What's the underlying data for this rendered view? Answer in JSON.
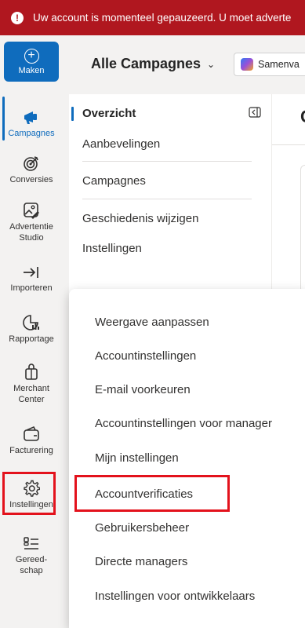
{
  "banner": {
    "message": "Uw account is momenteel gepauzeerd. U moet adverte"
  },
  "rail": {
    "create_label": "Maken",
    "items": [
      {
        "label": "Campagnes",
        "icon": "megaphone-icon"
      },
      {
        "label": "Conversies",
        "icon": "target-icon"
      },
      {
        "label": "Advertentie Studio",
        "icon": "image-edit-icon"
      },
      {
        "label": "Importeren",
        "icon": "import-arrow-icon"
      },
      {
        "label": "Rapportage",
        "icon": "report-chart-icon"
      },
      {
        "label": "Merchant Center",
        "icon": "shopping-bag-icon"
      },
      {
        "label": "Facturering",
        "icon": "wallet-icon"
      },
      {
        "label": "Instellingen",
        "icon": "gear-icon"
      },
      {
        "label": "Gereed-\nschap",
        "icon": "tools-icon"
      }
    ]
  },
  "topbar": {
    "title": "Alle Campagnes",
    "summary_label": "Samenva"
  },
  "subnav": {
    "items": [
      "Overzicht",
      "Aanbevelingen",
      "Campagnes",
      "Geschiedenis wijzigen",
      "Instellingen"
    ]
  },
  "main": {
    "heading": "C"
  },
  "flyout": {
    "items": [
      "Weergave aanpassen",
      "Accountinstellingen",
      "E-mail voorkeuren",
      "Accountinstellingen voor manager",
      "Mijn instellingen",
      "Accountverificaties",
      "Gebruikersbeheer",
      "Directe managers",
      "Instellingen voor ontwikkelaars"
    ]
  },
  "colors": {
    "banner": "#b0171f",
    "accent": "#0f6cbd",
    "highlight": "#e3121c"
  }
}
